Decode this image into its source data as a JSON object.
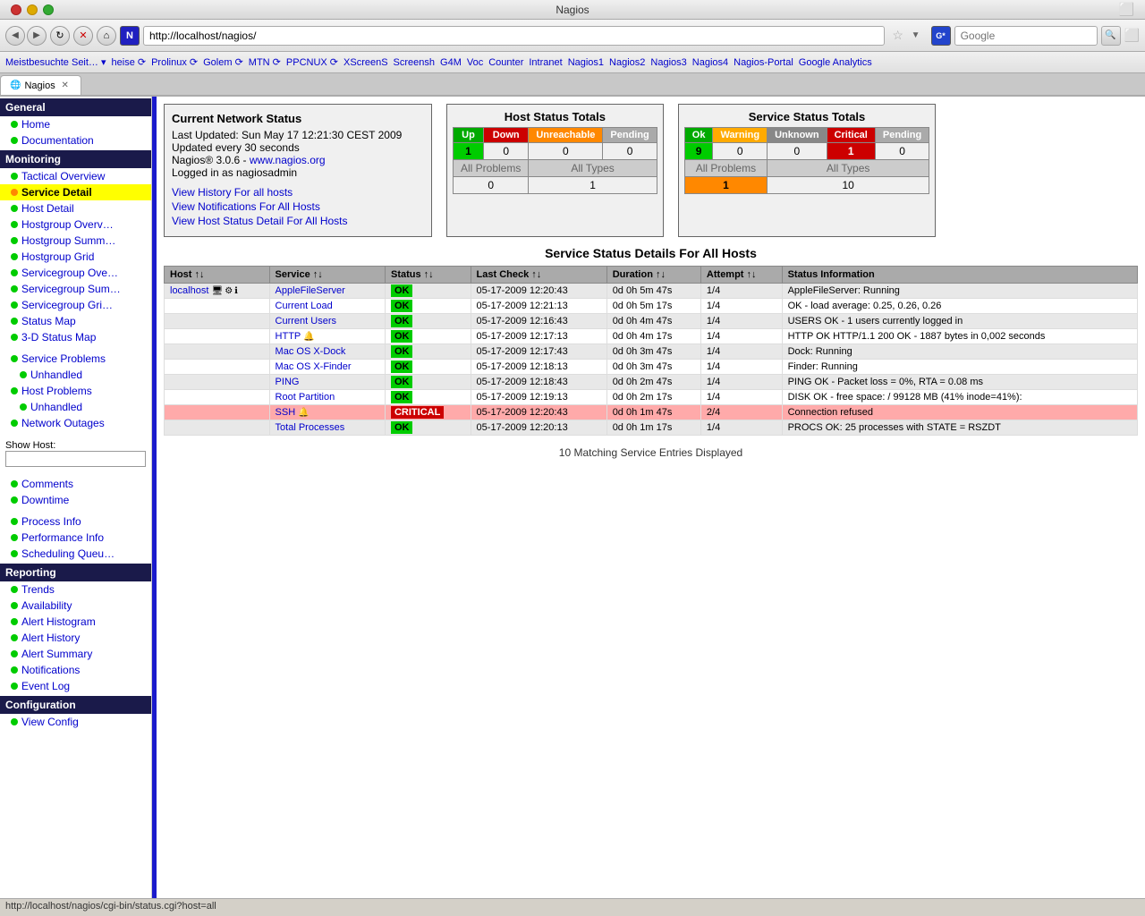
{
  "browser": {
    "title": "Nagios",
    "url": "http://localhost/nagios/",
    "tab_label": "Nagios",
    "search_placeholder": "Google",
    "search_engine_label": "G*",
    "statusbar_url": "http://localhost/nagios/cgi-bin/status.cgi?host=all"
  },
  "bookmarks": [
    "Meistbesuchte Seit…",
    "heise",
    "Prolinux",
    "Golem",
    "MTN",
    "PPCNUX",
    "XScreenS",
    "Screensh",
    "G4M",
    "Voc",
    "Counter",
    "Intranet",
    "Nagios1",
    "Nagios2",
    "Nagios3",
    "Nagios4",
    "Nagios-Portal",
    "Google Analytics"
  ],
  "sidebar": {
    "sections": [
      {
        "label": "General",
        "items": [
          {
            "label": "Home",
            "dot": "green",
            "selected": false
          },
          {
            "label": "Documentation",
            "dot": "green",
            "selected": false
          }
        ]
      },
      {
        "label": "Monitoring",
        "items": [
          {
            "label": "Tactical Overview",
            "dot": "green",
            "selected": false
          },
          {
            "label": "Service Detail",
            "dot": "orange",
            "selected": true
          },
          {
            "label": "Host Detail",
            "dot": "green",
            "selected": false
          },
          {
            "label": "Hostgroup Overv…",
            "dot": "green",
            "selected": false
          },
          {
            "label": "Hostgroup Summ…",
            "dot": "green",
            "selected": false
          },
          {
            "label": "Hostgroup Grid",
            "dot": "green",
            "selected": false
          },
          {
            "label": "Servicegroup Ove…",
            "dot": "green",
            "selected": false
          },
          {
            "label": "Servicegroup Sum…",
            "dot": "green",
            "selected": false
          },
          {
            "label": "Servicegroup Gri…",
            "dot": "green",
            "selected": false
          },
          {
            "label": "Status Map",
            "dot": "green",
            "selected": false
          },
          {
            "label": "3-D Status Map",
            "dot": "green",
            "selected": false
          }
        ]
      },
      {
        "label": "",
        "items": [
          {
            "label": "Service Problems",
            "dot": "green",
            "selected": false
          },
          {
            "label": "Unhandled",
            "dot": "green",
            "selected": false,
            "indent": true
          },
          {
            "label": "Host Problems",
            "dot": "green",
            "selected": false
          },
          {
            "label": "Unhandled",
            "dot": "green",
            "selected": false,
            "indent": true
          },
          {
            "label": "Network Outages",
            "dot": "green",
            "selected": false
          }
        ]
      },
      {
        "label": "",
        "items": [
          {
            "label": "Comments",
            "dot": "green",
            "selected": false
          },
          {
            "label": "Downtime",
            "dot": "green",
            "selected": false
          }
        ]
      },
      {
        "label": "",
        "items": [
          {
            "label": "Process Info",
            "dot": "green",
            "selected": false
          },
          {
            "label": "Performance Info",
            "dot": "green",
            "selected": false
          },
          {
            "label": "Scheduling Queu…",
            "dot": "green",
            "selected": false
          }
        ]
      },
      {
        "label": "Reporting",
        "items": [
          {
            "label": "Trends",
            "dot": "green",
            "selected": false
          },
          {
            "label": "Availability",
            "dot": "green",
            "selected": false
          },
          {
            "label": "Alert Histogram",
            "dot": "green",
            "selected": false
          },
          {
            "label": "Alert History",
            "dot": "green",
            "selected": false
          },
          {
            "label": "Alert Summary",
            "dot": "green",
            "selected": false
          },
          {
            "label": "Notifications",
            "dot": "green",
            "selected": false
          },
          {
            "label": "Event Log",
            "dot": "green",
            "selected": false
          }
        ]
      },
      {
        "label": "Configuration",
        "items": [
          {
            "label": "View Config",
            "dot": "green",
            "selected": false
          }
        ]
      }
    ]
  },
  "network_status": {
    "title": "Current Network Status",
    "last_updated": "Last Updated: Sun May 17 12:21:30 CEST 2009",
    "update_interval": "Updated every 30 seconds",
    "version": "Nagios® 3.0.6 - ",
    "version_link": "www.nagios.org",
    "logged_in": "Logged in as nagiosadmin",
    "links": [
      "View History For all hosts",
      "View Notifications For All Hosts",
      "View Host Status Detail For All Hosts"
    ]
  },
  "host_status_totals": {
    "title": "Host Status Totals",
    "headers": [
      "Up",
      "Down",
      "Unreachable",
      "Pending"
    ],
    "values": [
      "1",
      "0",
      "0",
      "0"
    ],
    "all_problems_label": "All Problems",
    "all_types_label": "All Types",
    "all_problems_val": "0",
    "all_types_val": "1"
  },
  "service_status_totals": {
    "title": "Service Status Totals",
    "headers": [
      "Ok",
      "Warning",
      "Unknown",
      "Critical",
      "Pending"
    ],
    "values": [
      "9",
      "0",
      "0",
      "1",
      "0"
    ],
    "all_problems_label": "All Problems",
    "all_types_label": "All Types",
    "all_problems_val": "1",
    "all_types_val": "10"
  },
  "service_detail": {
    "title": "Service Status Details For All Hosts",
    "columns": [
      "Host",
      "Service",
      "Status",
      "Last Check",
      "Duration",
      "Attempt",
      "Status Information"
    ],
    "rows": [
      {
        "host": "localhost",
        "service": "AppleFileServer",
        "status": "OK",
        "status_type": "ok",
        "last_check": "05-17-2009 12:20:43",
        "duration": "0d 0h 5m 47s",
        "attempt": "1/4",
        "info": "AppleFileServer: Running",
        "host_show": true,
        "row_class": "row-even"
      },
      {
        "host": "",
        "service": "Current Load",
        "status": "OK",
        "status_type": "ok",
        "last_check": "05-17-2009 12:21:13",
        "duration": "0d 0h 5m 17s",
        "attempt": "1/4",
        "info": "OK - load average: 0.25, 0.26, 0.26",
        "row_class": "row-odd"
      },
      {
        "host": "",
        "service": "Current Users",
        "status": "OK",
        "status_type": "ok",
        "last_check": "05-17-2009 12:16:43",
        "duration": "0d 0h 4m 47s",
        "attempt": "1/4",
        "info": "USERS OK - 1 users currently logged in",
        "row_class": "row-even"
      },
      {
        "host": "",
        "service": "HTTP",
        "status": "OK",
        "status_type": "ok",
        "last_check": "05-17-2009 12:17:13",
        "duration": "0d 0h 4m 17s",
        "attempt": "1/4",
        "info": "HTTP OK HTTP/1.1 200 OK - 1887 bytes in 0,002 seconds",
        "has_icon": true,
        "row_class": "row-odd"
      },
      {
        "host": "",
        "service": "Mac OS X-Dock",
        "status": "OK",
        "status_type": "ok",
        "last_check": "05-17-2009 12:17:43",
        "duration": "0d 0h 3m 47s",
        "attempt": "1/4",
        "info": "Dock: Running",
        "row_class": "row-even"
      },
      {
        "host": "",
        "service": "Mac OS X-Finder",
        "status": "OK",
        "status_type": "ok",
        "last_check": "05-17-2009 12:18:13",
        "duration": "0d 0h 3m 47s",
        "attempt": "1/4",
        "info": "Finder: Running",
        "row_class": "row-odd"
      },
      {
        "host": "",
        "service": "PING",
        "status": "OK",
        "status_type": "ok",
        "last_check": "05-17-2009 12:18:43",
        "duration": "0d 0h 2m 47s",
        "attempt": "1/4",
        "info": "PING OK - Packet loss = 0%, RTA = 0.08 ms",
        "row_class": "row-even"
      },
      {
        "host": "",
        "service": "Root Partition",
        "status": "OK",
        "status_type": "ok",
        "last_check": "05-17-2009 12:19:13",
        "duration": "0d 0h 2m 17s",
        "attempt": "1/4",
        "info": "DISK OK - free space: / 99128 MB (41% inode=41%):",
        "row_class": "row-odd"
      },
      {
        "host": "",
        "service": "SSH",
        "status": "CRITICAL",
        "status_type": "critical",
        "last_check": "05-17-2009 12:20:43",
        "duration": "0d 0h 1m 47s",
        "attempt": "2/4",
        "info": "Connection refused",
        "has_icon": true,
        "row_class": "row-critical"
      },
      {
        "host": "",
        "service": "Total Processes",
        "status": "OK",
        "status_type": "ok",
        "last_check": "05-17-2009 12:20:13",
        "duration": "0d 0h 1m 17s",
        "attempt": "1/4",
        "info": "PROCS OK: 25 processes with STATE = RSZDT",
        "row_class": "row-even"
      }
    ],
    "matching_text": "10 Matching Service Entries Displayed"
  }
}
